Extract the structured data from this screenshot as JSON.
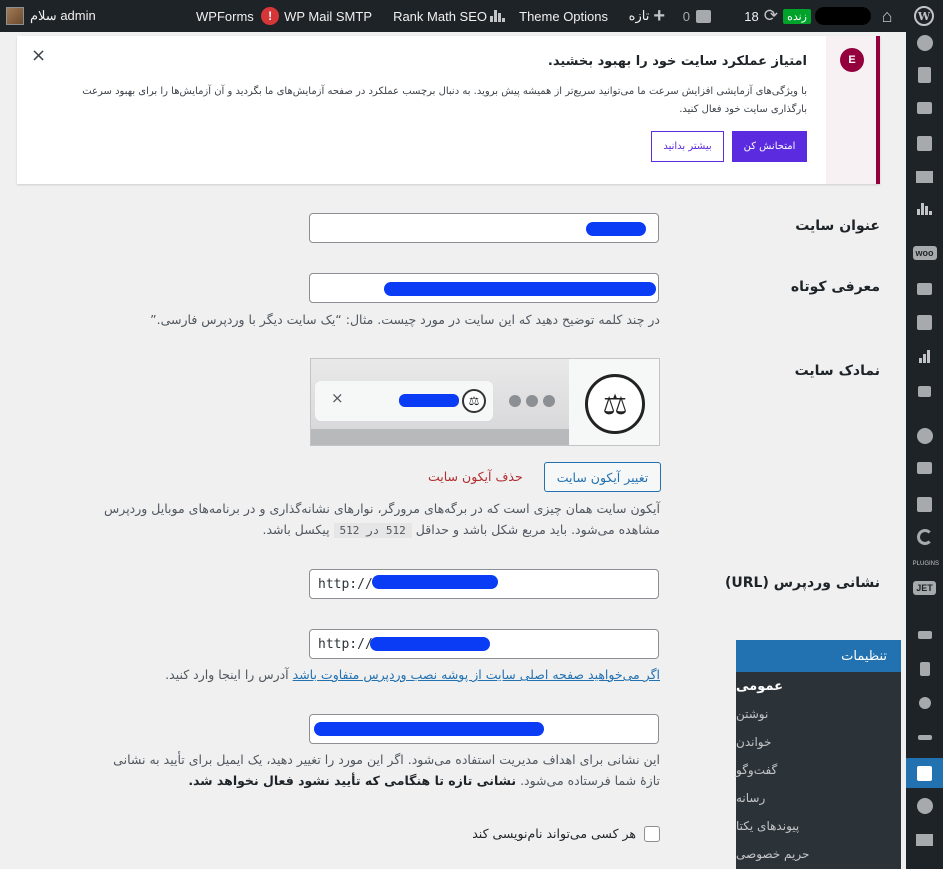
{
  "adminbar": {
    "account": "سلام admin",
    "wpforms": "WPForms",
    "smtp_alert": "!",
    "smtp": "WP Mail SMTP",
    "rankmath": "Rank Math SEO",
    "theme_options": "Theme Options",
    "new": "تازه",
    "comments_count": "0",
    "updates_count": "18",
    "live": "زنده",
    "wp_logo": "W"
  },
  "notice": {
    "logo": "E",
    "title": "امتیاز عملکرد سایت خود را بهبود بخشید.",
    "description": "با ویژگی‌های آزمایشی افزایش سرعت ما می‌توانید سریع‌تر از همیشه پیش بروید. به دنبال برچسب عملکرد در صفحه آزمایش‌های ما بگردید و آن آزمایش‌ها را برای بهبود سرعت بارگذاری سایت خود فعال کنید.",
    "primary_button": "امتحانش کن",
    "secondary_button": "بیشتر بدانید",
    "close": "×"
  },
  "form": {
    "site_title_label": "عنوان سایت",
    "tagline_label": "معرفی کوتاه",
    "tagline_help": "در چند کلمه توضیح دهید که این سایت در مورد چیست. مثال: “یک سایت دیگر با وردپرس فارسی.”",
    "site_icon_label": "نمادک سایت",
    "change_icon_button": "تغییر آیکون سایت",
    "remove_icon_link": "حذف آیکون سایت",
    "icon_help_1": "آیکون سایت همان چیزی است که در برگه‌های مرورگر، نوارهای نشانه‌گذاری و در برنامه‌های موبایل وردپرس",
    "icon_help_2a": "مشاهده می‌شود. باید مربع شکل باشد و حداقل",
    "icon_size": "512 در 512",
    "icon_help_2b": "پیکسل باشد.",
    "wp_url_label": "نشانی وردپرس (URL)",
    "wp_url_value": "http://",
    "site_url_value": "http://",
    "site_url_help_link": "اگر می‌خواهید صفحه اصلی سایت از پوشه نصب وردپرس متفاوت باشد",
    "site_url_help_rest": "آدرس را اینجا وارد کنید.",
    "email_help_1": "این نشانی برای اهداف مدیریت استفاده می‌شود. اگر این مورد را تغییر دهید، یک ایمیل برای تأیید به نشانی",
    "email_help_2a": "تازهٔ شما فرستاده می‌شود.",
    "email_help_2b": "نشانی تازه تا هنگامی که تأیید نشود فعال نخواهد شد.",
    "membership_label": "هر کسی می‌تواند نام‌نویسی کند"
  },
  "submenu": {
    "header": "تنظیمات",
    "items": [
      "عمومی",
      "نوشتن",
      "خواندن",
      "گفت‌وگو",
      "رسانه",
      "پیوندهای یکتا",
      "حریم خصوصی"
    ]
  },
  "sidebar": {
    "plugins_tag": "PLUGINS",
    "woo_tag": "woo",
    "jet_tag": "JET"
  }
}
